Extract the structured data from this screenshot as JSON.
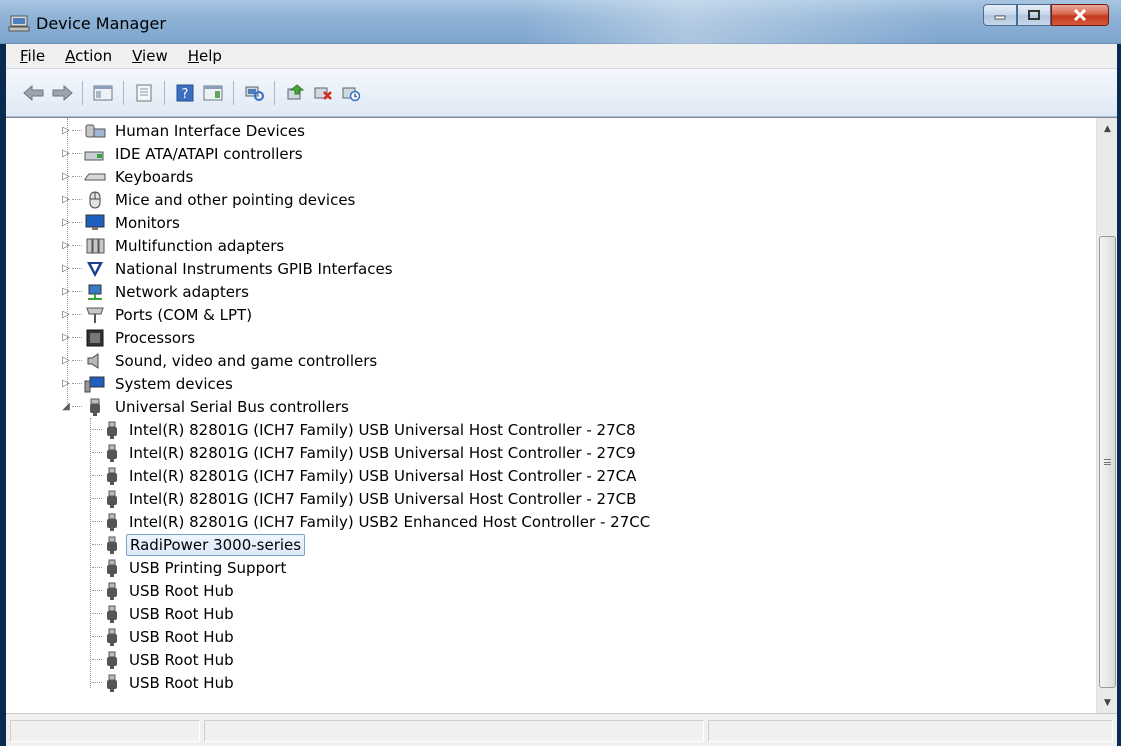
{
  "window": {
    "title": "Device Manager"
  },
  "menu": {
    "items": [
      {
        "label": "File",
        "accel": "F",
        "rest": "ile"
      },
      {
        "label": "Action",
        "accel": "A",
        "rest": "ction"
      },
      {
        "label": "View",
        "accel": "V",
        "rest": "iew"
      },
      {
        "label": "Help",
        "accel": "H",
        "rest": "elp"
      }
    ]
  },
  "toolbar": {
    "buttons": [
      "back-icon",
      "forward-icon",
      "show-hide-console-tree-icon",
      "properties-icon",
      "help-icon",
      "show-hide-action-pane-icon",
      "scan-hardware-icon",
      "update-driver-icon",
      "uninstall-icon",
      "disable-icon"
    ]
  },
  "tree": {
    "categories": [
      {
        "label": "Human Interface Devices",
        "icon": "hid-icon"
      },
      {
        "label": "IDE ATA/ATAPI controllers",
        "icon": "ide-controller-icon"
      },
      {
        "label": "Keyboards",
        "icon": "keyboard-icon"
      },
      {
        "label": "Mice and other pointing devices",
        "icon": "mouse-icon"
      },
      {
        "label": "Monitors",
        "icon": "monitor-icon"
      },
      {
        "label": "Multifunction adapters",
        "icon": "multifunction-adapter-icon"
      },
      {
        "label": "National Instruments GPIB Interfaces",
        "icon": "ni-gpib-icon"
      },
      {
        "label": "Network adapters",
        "icon": "network-adapter-icon"
      },
      {
        "label": "Ports (COM & LPT)",
        "icon": "port-icon"
      },
      {
        "label": "Processors",
        "icon": "processor-icon"
      },
      {
        "label": "Sound, video and game controllers",
        "icon": "sound-icon"
      },
      {
        "label": "System devices",
        "icon": "system-devices-icon"
      },
      {
        "label": "Universal Serial Bus controllers",
        "icon": "usb-icon"
      }
    ],
    "usb_children": [
      {
        "label": "Intel(R) 82801G (ICH7 Family) USB Universal Host Controller - 27C8"
      },
      {
        "label": "Intel(R) 82801G (ICH7 Family) USB Universal Host Controller - 27C9"
      },
      {
        "label": "Intel(R) 82801G (ICH7 Family) USB Universal Host Controller - 27CA"
      },
      {
        "label": "Intel(R) 82801G (ICH7 Family) USB Universal Host Controller - 27CB"
      },
      {
        "label": "Intel(R) 82801G (ICH7 Family) USB2 Enhanced Host Controller - 27CC"
      },
      {
        "label": "RadiPower 3000-series",
        "selected": true
      },
      {
        "label": "USB Printing Support"
      },
      {
        "label": "USB Root Hub"
      },
      {
        "label": "USB Root Hub"
      },
      {
        "label": "USB Root Hub"
      },
      {
        "label": "USB Root Hub"
      },
      {
        "label": "USB Root Hub"
      }
    ]
  },
  "colors": {
    "selection_border": "#7da2ce",
    "title_bar": "#8fb2d6",
    "close_button": "#c2381d"
  }
}
